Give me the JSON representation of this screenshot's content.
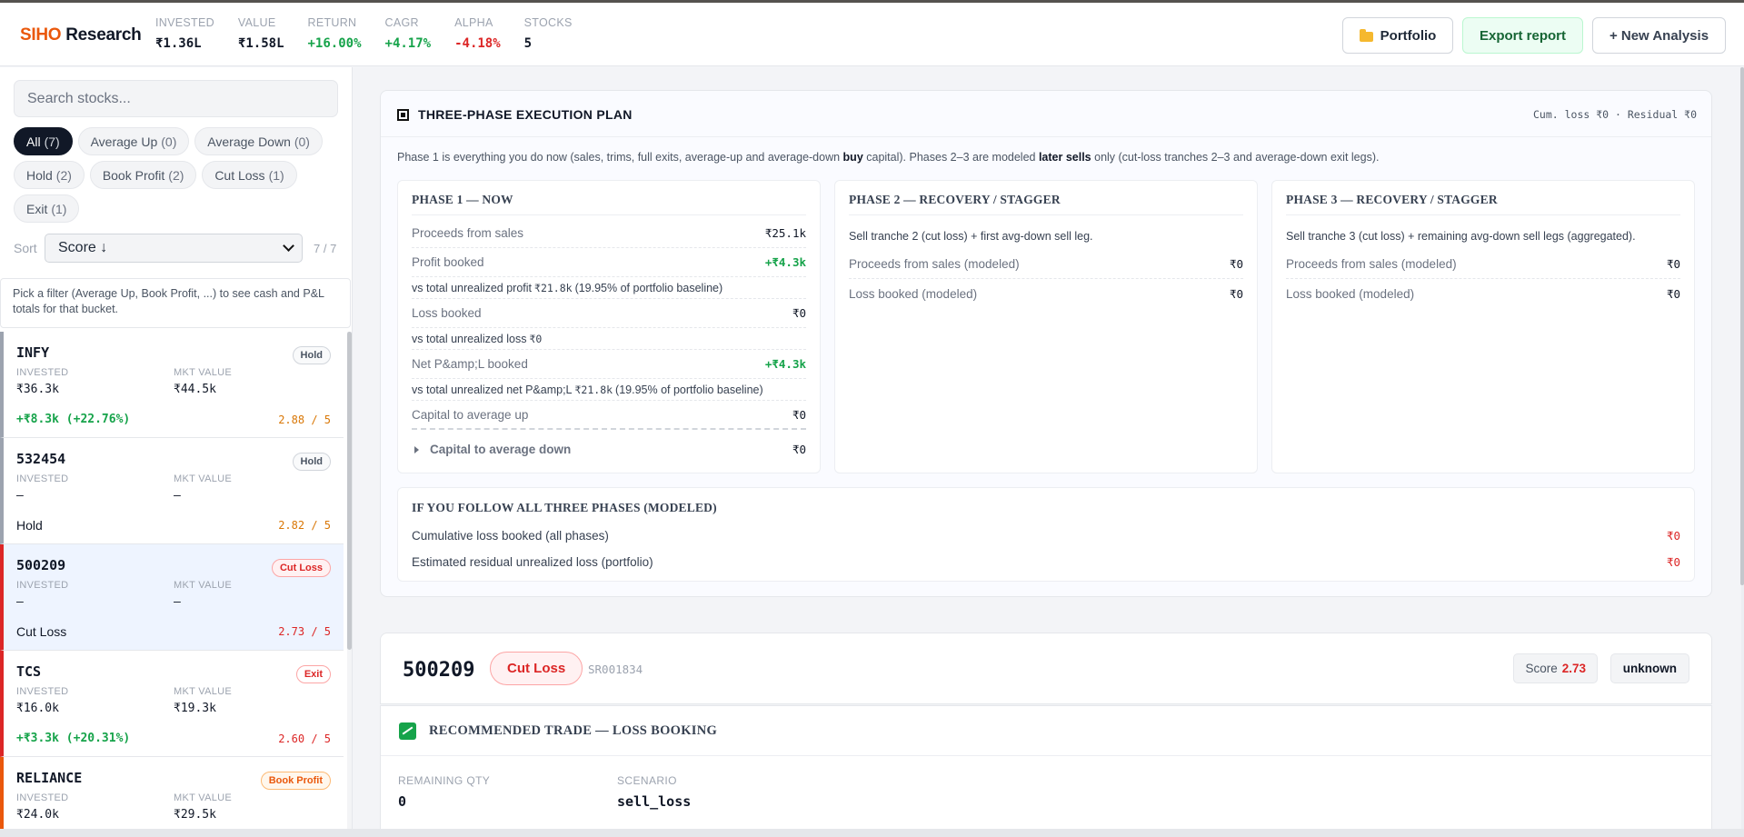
{
  "brand": {
    "part1": "SIHO",
    "part2": " Research"
  },
  "stats": [
    {
      "label": "INVESTED",
      "value": "₹1.36L",
      "tone": ""
    },
    {
      "label": "VALUE",
      "value": "₹1.58L",
      "tone": ""
    },
    {
      "label": "RETURN",
      "value": "+16.00%",
      "tone": "green"
    },
    {
      "label": "CAGR",
      "value": "+4.17%",
      "tone": "green"
    },
    {
      "label": "ALPHA",
      "value": "-4.18%",
      "tone": "red"
    },
    {
      "label": "STOCKS",
      "value": "5",
      "tone": ""
    }
  ],
  "header_buttons": {
    "portfolio": "Portfolio",
    "export": "Export report",
    "new_analysis": "+ New Analysis"
  },
  "sidebar": {
    "search_placeholder": "Search stocks...",
    "filters": [
      {
        "label": "All",
        "count": "(7)",
        "active": true
      },
      {
        "label": "Average Up",
        "count": "(0)",
        "active": false
      },
      {
        "label": "Average Down",
        "count": "(0)",
        "active": false
      },
      {
        "label": "Hold",
        "count": "(2)",
        "active": false
      },
      {
        "label": "Book Profit",
        "count": "(2)",
        "active": false
      },
      {
        "label": "Cut Loss",
        "count": "(1)",
        "active": false
      },
      {
        "label": "Exit",
        "count": "(1)",
        "active": false
      }
    ],
    "sort_label": "Sort",
    "sort_value": "Score ↓",
    "sort_count": "7 / 7",
    "hint": "Pick a filter (Average Up, Book Profit, ...) to see cash and P&L totals for that bucket.",
    "invested_label": "INVESTED",
    "mkt_label": "MKT VALUE",
    "stocks": [
      {
        "symbol": "INFY",
        "badge": "Hold",
        "badge_kind": "hold",
        "invested": "₹36.3k",
        "mkt": "₹44.5k",
        "foot": "+₹8.3k (+22.76%)",
        "foot_kind": "pnl",
        "score": "2.88 / 5",
        "border": "#9ca3af",
        "selected": false
      },
      {
        "symbol": "532454",
        "badge": "Hold",
        "badge_kind": "hold",
        "invested": "–",
        "mkt": "–",
        "foot": "Hold",
        "foot_kind": "action",
        "score": "2.82 / 5",
        "border": "#9ca3af",
        "selected": false
      },
      {
        "symbol": "500209",
        "badge": "Cut Loss",
        "badge_kind": "cut",
        "invested": "–",
        "mkt": "–",
        "foot": "Cut Loss",
        "foot_kind": "action",
        "score": "2.73 / 5",
        "border": "#dc2626",
        "selected": true
      },
      {
        "symbol": "TCS",
        "badge": "Exit",
        "badge_kind": "exit",
        "invested": "₹16.0k",
        "mkt": "₹19.3k",
        "foot": "+₹3.3k (+20.31%)",
        "foot_kind": "pnl",
        "score": "2.60 / 5",
        "border": "#dc2626",
        "selected": false
      },
      {
        "symbol": "RELIANCE",
        "badge": "Book Profit",
        "badge_kind": "book",
        "invested": "₹24.0k",
        "mkt": "₹29.5k",
        "foot": "",
        "foot_kind": "pnl",
        "score": "",
        "border": "#ea580c",
        "selected": false
      }
    ]
  },
  "plan": {
    "title": "THREE-PHASE EXECUTION PLAN",
    "meta": "Cum. loss ₹0 · Residual ₹0",
    "desc_a": "Phase 1 is everything you do now (sales, trims, full exits, average-up and average-down ",
    "desc_b": "buy",
    "desc_c": " capital). Phases 2–3 are modeled ",
    "desc_d": "later sells",
    "desc_e": " only (cut-loss tranches 2–3 and average-down exit legs).",
    "phase1": {
      "title": "PHASE 1 — NOW",
      "proceeds_label": "Proceeds from sales",
      "proceeds": "₹25.1k",
      "profit_label": "Profit booked",
      "profit": "+₹4.3k",
      "profit_sub_a": "vs total unrealized profit",
      "profit_sub_m": "₹21.8k",
      "profit_sub_b": "(19.95% of portfolio baseline)",
      "loss_label": "Loss booked",
      "loss": "₹0",
      "loss_sub_a": "vs total unrealized loss",
      "loss_sub_m": "₹0",
      "net_label": "Net P&amp;L booked",
      "net": "+₹4.3k",
      "net_sub_a": "vs total unrealized net P&amp;L",
      "net_sub_m": "₹21.8k",
      "net_sub_b": "(19.95% of portfolio baseline)",
      "up_label": "Capital to average up",
      "up": "₹0",
      "down_label": "Capital to average down",
      "down": "₹0"
    },
    "phase2": {
      "title": "PHASE 2 — RECOVERY / STAGGER",
      "desc": "Sell tranche 2 (cut loss) + first avg-down sell leg.",
      "proceeds_label": "Proceeds from sales (modeled)",
      "proceeds": "₹0",
      "loss_label": "Loss booked (modeled)",
      "loss": "₹0"
    },
    "phase3": {
      "title": "PHASE 3 — RECOVERY / STAGGER",
      "desc": "Sell tranche 3 (cut loss) + remaining avg-down sell legs (aggregated).",
      "proceeds_label": "Proceeds from sales (modeled)",
      "proceeds": "₹0",
      "loss_label": "Loss booked (modeled)",
      "loss": "₹0"
    },
    "follow": {
      "title": "IF YOU FOLLOW ALL THREE PHASES (MODELED)",
      "cum_label": "Cumulative loss booked (all phases)",
      "cum": "₹0",
      "res_label": "Estimated residual unrealized loss (portfolio)",
      "res": "₹0"
    }
  },
  "detail": {
    "symbol": "500209",
    "action": "Cut Loss",
    "isin": "SR001834",
    "score_label": "Score",
    "score": "2.73",
    "tag": "unknown"
  },
  "trade": {
    "title": "RECOMMENDED TRADE — LOSS BOOKING",
    "qty_label": "REMAINING QTY",
    "qty": "0",
    "scenario_label": "SCENARIO",
    "scenario": "sell_loss"
  }
}
